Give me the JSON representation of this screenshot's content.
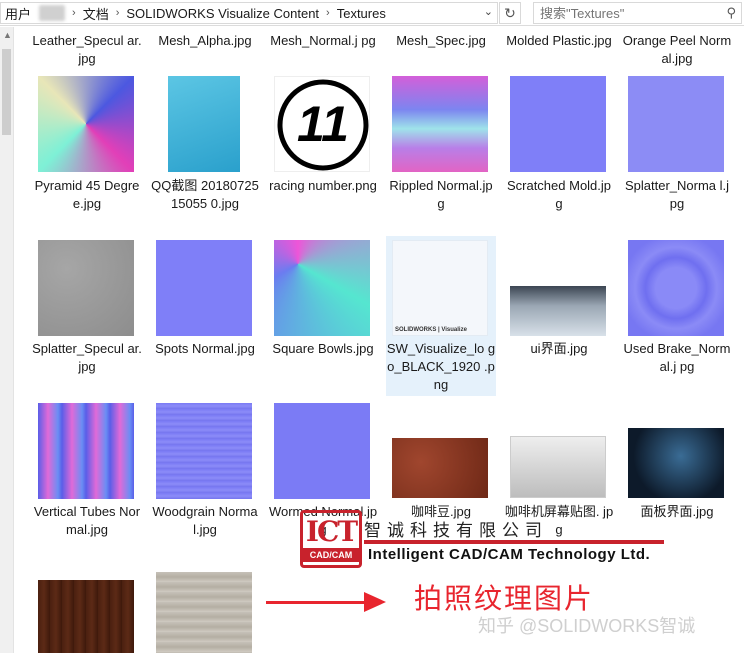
{
  "address_bar": {
    "crumbs": [
      "用户",
      "文档",
      "SOLIDWORKS Visualize Content",
      "Textures"
    ],
    "dropdown_glyph": "⌄",
    "refresh_glyph": "↻"
  },
  "search": {
    "placeholder": "搜索\"Textures\"",
    "icon": "search-icon"
  },
  "files": [
    {
      "name": "Leather_Specular.jpg",
      "label": "Leather_Specul ar.jpg"
    },
    {
      "name": "Mesh_Alpha.jpg",
      "label": "Mesh_Alpha.jpg"
    },
    {
      "name": "Mesh_Normal.jpg",
      "label": "Mesh_Normal.j pg"
    },
    {
      "name": "Mesh_Spec.jpg",
      "label": "Mesh_Spec.jpg"
    },
    {
      "name": "Molded Plastic.jpg",
      "label": "Molded Plastic.jpg"
    },
    {
      "name": "Orange Peel Normal.jpg",
      "label": "Orange Peel Normal.jpg"
    },
    {
      "name": "Pyramid 45 Degree.jpg",
      "label": "Pyramid 45 Degree.jpg"
    },
    {
      "name": "QQ截图20180725150550.jpg",
      "label": "QQ截图 2018072515055 0.jpg"
    },
    {
      "name": "racing number.png",
      "label": "racing number.png",
      "thumb_text": "11"
    },
    {
      "name": "Rippled Normal.jpg",
      "label": "Rippled Normal.jpg"
    },
    {
      "name": "Scratched Mold.jpg",
      "label": "Scratched Mold.jpg"
    },
    {
      "name": "Splatter_Normal.jpg",
      "label": "Splatter_Norma l.jpg"
    },
    {
      "name": "Splatter_Specular.jpg",
      "label": "Splatter_Specul ar.jpg"
    },
    {
      "name": "Spots Normal.jpg",
      "label": "Spots Normal.jpg"
    },
    {
      "name": "Square Bowls.jpg",
      "label": "Square Bowls.jpg"
    },
    {
      "name": "SW_Visualize_logo_BLACK_1920.png",
      "label": "SW_Visualize_lo go_BLACK_1920 .png",
      "thumb_text": "SOLIDWORKS | Visualize"
    },
    {
      "name": "ui界面.jpg",
      "label": "ui界面.jpg"
    },
    {
      "name": "Used Brake_Normal.jpg",
      "label": "Used Brake_Normal.j pg"
    },
    {
      "name": "Vertical Tubes Normal.jpg",
      "label": "Vertical Tubes Normal.jpg"
    },
    {
      "name": "Woodgrain Normal.jpg",
      "label": "Woodgrain Normal.jpg"
    },
    {
      "name": "Wormed Normal.jpg",
      "label": "Wormed Normal.jpg"
    },
    {
      "name": "咖啡豆.jpg",
      "label": "咖啡豆.jpg"
    },
    {
      "name": "咖啡机屏幕贴图.jpg",
      "label": "咖啡机屏幕贴图. jpg"
    },
    {
      "name": "面板界面.jpg",
      "label": "面板界面.jpg"
    }
  ],
  "overlay": {
    "logo_text": "ICT",
    "logo_sub": "CAD/CAM",
    "company_cn": "智诚科技有限公司",
    "company_en": "Intelligent CAD/CAM Technology Ltd.",
    "caption": "拍照纹理图片",
    "watermark": "知乎 @SOLIDWORKS智诚"
  }
}
